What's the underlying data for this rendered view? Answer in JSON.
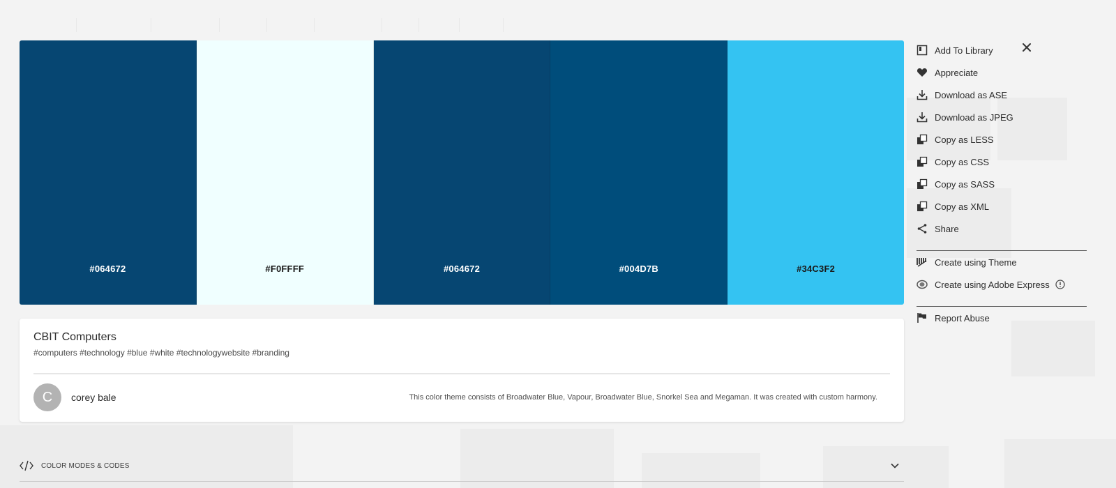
{
  "palette": {
    "swatches": [
      {
        "hex": "#064672",
        "text_color": "#ffffff"
      },
      {
        "hex": "#F0FFFF",
        "text_color": "#1a1a1a"
      },
      {
        "hex": "#064672",
        "text_color": "#ffffff"
      },
      {
        "hex": "#004D7B",
        "text_color": "#ffffff"
      },
      {
        "hex": "#34C3F2",
        "text_color": "#1a1a1a"
      }
    ]
  },
  "theme": {
    "title": "CBIT Computers",
    "tags": "#computers #technology #blue #white #technologywebsite #branding",
    "author_initial": "C",
    "author_name": "corey bale",
    "description": "This color theme consists of Broadwater Blue, Vapour, Broadwater Blue, Snorkel Sea and Megaman. It was created with custom harmony."
  },
  "menu": {
    "group1": [
      {
        "label": "Add To Library",
        "icon": "library-icon"
      },
      {
        "label": "Appreciate",
        "icon": "heart-icon"
      },
      {
        "label": "Download as ASE",
        "icon": "download-icon"
      },
      {
        "label": "Download as JPEG",
        "icon": "download-icon"
      },
      {
        "label": "Copy as LESS",
        "icon": "copy-icon"
      },
      {
        "label": "Copy as CSS",
        "icon": "copy-icon"
      },
      {
        "label": "Copy as SASS",
        "icon": "copy-icon"
      },
      {
        "label": "Copy as XML",
        "icon": "copy-icon"
      },
      {
        "label": "Share",
        "icon": "share-icon"
      }
    ],
    "group2": [
      {
        "label": "Create using Theme",
        "icon": "brush-icon"
      },
      {
        "label": "Create using Adobe Express",
        "icon": "express-icon"
      }
    ],
    "group3": [
      {
        "label": "Report Abuse",
        "icon": "flag-icon"
      }
    ],
    "close_icon": "close-icon"
  },
  "color_modes": {
    "label": "COLOR MODES & CODES"
  }
}
